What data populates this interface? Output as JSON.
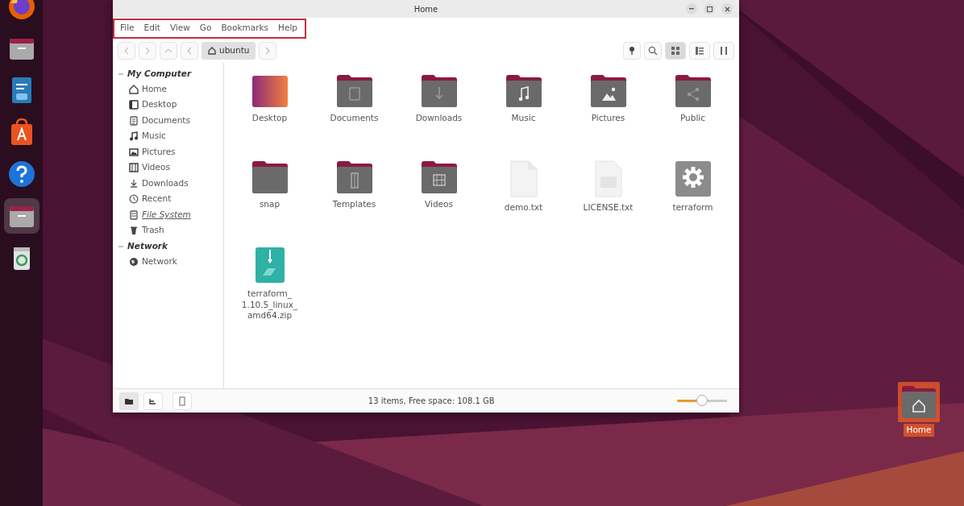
{
  "dock": [
    {
      "kind": "browser",
      "active": false
    },
    {
      "kind": "files",
      "active": false
    },
    {
      "kind": "writer",
      "active": false
    },
    {
      "kind": "store",
      "active": false
    },
    {
      "kind": "help",
      "active": false
    },
    {
      "kind": "files",
      "active": true
    },
    {
      "kind": "trash",
      "active": false
    }
  ],
  "window": {
    "title": "Home"
  },
  "menu_bar": {
    "highlighted": true,
    "items": [
      "File",
      "Edit",
      "View",
      "Go",
      "Bookmarks",
      "Help"
    ]
  },
  "toolbar": {
    "path": "ubuntu",
    "views": [
      {
        "kind": "grid",
        "selected": true
      },
      {
        "kind": "list",
        "selected": false
      },
      {
        "kind": "compact",
        "selected": false
      }
    ]
  },
  "sidebar": [
    {
      "title": "My Computer",
      "expanded": true,
      "items": [
        {
          "label": "Home",
          "kind": "home",
          "hovered": false
        },
        {
          "label": "Desktop",
          "kind": "desktop",
          "hovered": false
        },
        {
          "label": "Documents",
          "kind": "documents",
          "hovered": false
        },
        {
          "label": "Music",
          "kind": "music",
          "hovered": false
        },
        {
          "label": "Pictures",
          "kind": "pictures",
          "hovered": false
        },
        {
          "label": "Videos",
          "kind": "videos",
          "hovered": false
        },
        {
          "label": "Downloads",
          "kind": "downloads",
          "hovered": false
        },
        {
          "label": "Recent",
          "kind": "recent",
          "hovered": false
        },
        {
          "label": "File System",
          "kind": "drive",
          "hovered": true
        },
        {
          "label": "Trash",
          "kind": "trash",
          "hovered": false
        }
      ]
    },
    {
      "title": "Network",
      "expanded": true,
      "items": [
        {
          "label": "Network",
          "kind": "network",
          "hovered": false
        }
      ]
    }
  ],
  "files": [
    {
      "name": "Desktop",
      "kind": "desktop"
    },
    {
      "name": "Documents",
      "kind": "documents"
    },
    {
      "name": "Downloads",
      "kind": "downloads"
    },
    {
      "name": "Music",
      "kind": "music"
    },
    {
      "name": "Pictures",
      "kind": "pictures"
    },
    {
      "name": "Public",
      "kind": "public"
    },
    {
      "name": "snap",
      "kind": "folder"
    },
    {
      "name": "Templates",
      "kind": "templates"
    },
    {
      "name": "Videos",
      "kind": "videos"
    },
    {
      "name": "demo.txt",
      "kind": "text"
    },
    {
      "name": "LICENSE.txt",
      "kind": "document"
    },
    {
      "name": "terraform",
      "kind": "executable"
    },
    {
      "name": "terraform_ 1.10.5_linux_ amd64.zip",
      "kind": "archive"
    }
  ],
  "status_bar": {
    "text": "13 items, Free space: 108.1 GB",
    "zoom": {
      "level": 0.5
    }
  },
  "desktop_icons": [
    {
      "label": "Home",
      "selected": true
    }
  ]
}
